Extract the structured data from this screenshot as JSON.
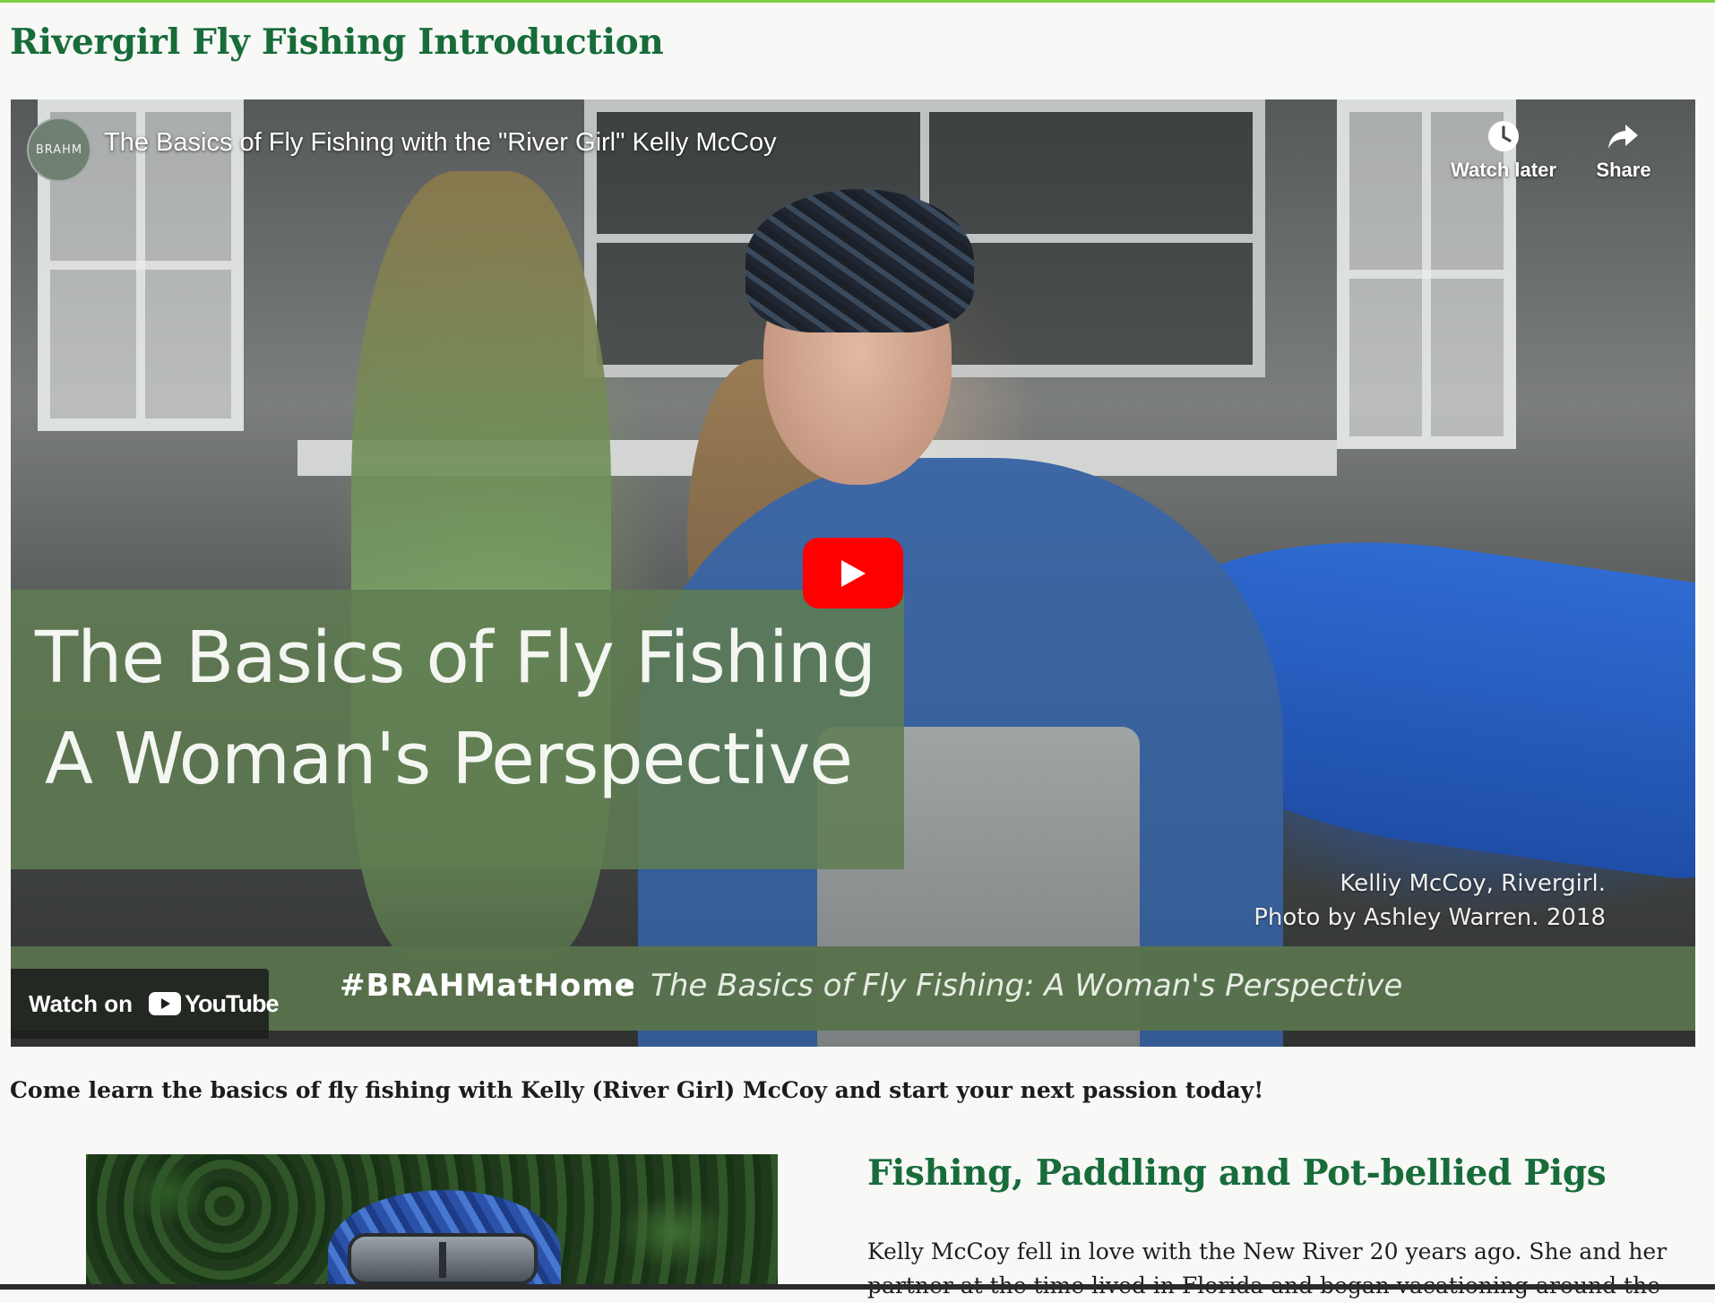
{
  "page": {
    "title": "Rivergirl Fly Fishing Introduction"
  },
  "video": {
    "channel_badge": "BRAHM",
    "title": "The Basics of Fly Fishing with the \"River Girl\" Kelly McCoy",
    "watch_later_label": "Watch later",
    "share_label": "Share",
    "banner_line1": "The Basics of Fly Fishing",
    "banner_line2": "A Woman's Perspective",
    "photo_credit_line1": "Kelliy McCoy, Rivergirl.",
    "photo_credit_line2": "Photo by Ashley Warren. 2018",
    "hashtag": "#BRAHMatHome",
    "subtitle": "The Basics of Fly Fishing: A Woman's Perspective",
    "watch_on_label": "Watch on",
    "youtube_label": "YouTube"
  },
  "intro_text": "Come learn the basics of fly fishing with Kelly (River Girl) McCoy and start your next passion today!",
  "section": {
    "title": "Fishing, Paddling and Pot-bellied Pigs",
    "paragraph": "Kelly McCoy fell in love with the New River 20 years ago. She and her partner at the time lived in Florida and began vacationing around the"
  },
  "colors": {
    "heading_green": "#176c3a",
    "top_rule": "#7fcf45",
    "banner_green": "#5f7d52",
    "youtube_red": "#ff0000"
  }
}
